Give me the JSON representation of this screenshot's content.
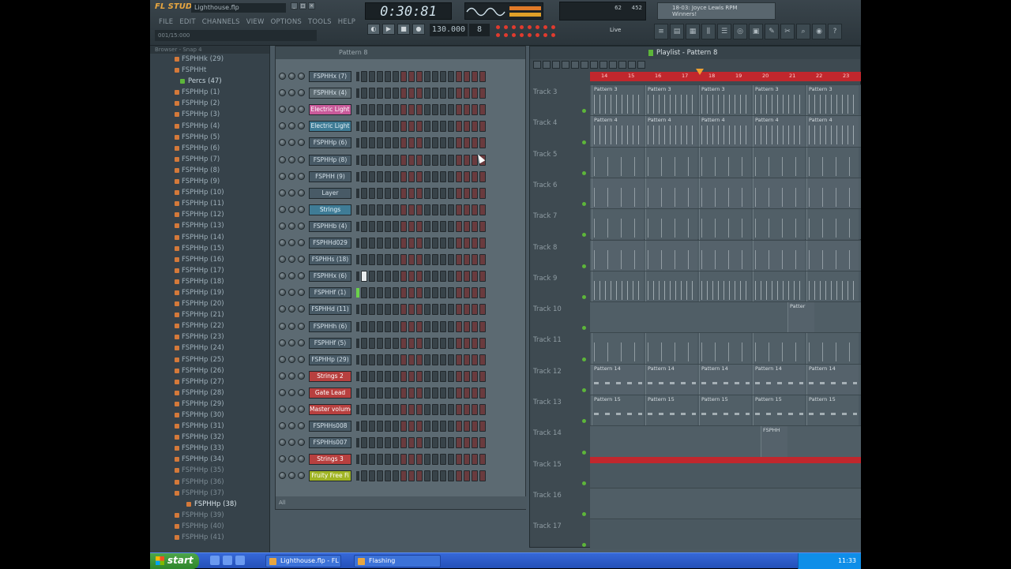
{
  "app": {
    "logo": "FL STUDIO",
    "title": "Lighthouse.flp"
  },
  "menu": [
    "FILE",
    "EDIT",
    "CHANNELS",
    "VIEW",
    "OPTIONS",
    "TOOLS",
    "HELP"
  ],
  "hint": "001/15:000",
  "transport": {
    "time": "0:30:81",
    "tempo": "130.000",
    "pattern": "8",
    "live": "Live",
    "cpu": "62",
    "mem": "452"
  },
  "news": "18-03: Joyce Lewis RPM Winners!",
  "browser": {
    "header": "Browser - Snap 4",
    "items": [
      "FSPHHk (29)",
      "FSPHHt",
      "Percs (47)",
      "FSPHHp (1)",
      "FSPHHp (2)",
      "FSPHHp (3)",
      "FSPHHp (4)",
      "FSPHHp (5)",
      "FSPHHp (6)",
      "FSPHHp (7)",
      "FSPHHp (8)",
      "FSPHHp (9)",
      "FSPHHp (10)",
      "FSPHHp (11)",
      "FSPHHp (12)",
      "FSPHHp (13)",
      "FSPHHp (14)",
      "FSPHHp (15)",
      "FSPHHp (16)",
      "FSPHHp (17)",
      "FSPHHp (18)",
      "FSPHHp (19)",
      "FSPHHp (20)",
      "FSPHHp (21)",
      "FSPHHp (22)",
      "FSPHHp (23)",
      "FSPHHp (24)",
      "FSPHHp (25)",
      "FSPHHp (26)",
      "FSPHHp (27)",
      "FSPHHp (28)",
      "FSPHHp (29)",
      "FSPHHp (30)",
      "FSPHHp (31)",
      "FSPHHp (32)",
      "FSPHHp (33)",
      "FSPHHp (34)",
      "FSPHHp (35)",
      "FSPHHp (36)",
      "FSPHHp (37)",
      "FSPHHp (38)",
      "FSPHHp (39)",
      "FSPHHp (40)",
      "FSPHHp (41)"
    ]
  },
  "sequencer": {
    "title": "Pattern 8",
    "footer": "All",
    "channels": [
      {
        "name": "FSPHHx (7)",
        "style": "",
        "sel": false
      },
      {
        "name": "FSPHHx (4)",
        "style": "grey",
        "sel": false
      },
      {
        "name": "Electric Light",
        "style": "pink",
        "sel": false
      },
      {
        "name": "Electric Light",
        "style": "teal",
        "sel": false
      },
      {
        "name": "FSPHHp (6)",
        "style": "",
        "sel": false
      },
      {
        "name": "FSPHHp (8)",
        "style": "",
        "sel": false
      },
      {
        "name": "FSPHH (9)",
        "style": "",
        "sel": false
      },
      {
        "name": "Layer",
        "style": "",
        "sel": false
      },
      {
        "name": "Strings",
        "style": "teal",
        "sel": false
      },
      {
        "name": "FSPHHb (4)",
        "style": "",
        "sel": false
      },
      {
        "name": "FSPHHd029",
        "style": "",
        "sel": false
      },
      {
        "name": "FSPHHs (18)",
        "style": "",
        "sel": false
      },
      {
        "name": "FSPHHx (6)",
        "style": "",
        "sel": false
      },
      {
        "name": "FSPHHf (1)",
        "style": "",
        "sel": true
      },
      {
        "name": "FSPHHd (11)",
        "style": "",
        "sel": false
      },
      {
        "name": "FSPHHh (6)",
        "style": "",
        "sel": false
      },
      {
        "name": "FSPHHf (5)",
        "style": "",
        "sel": false
      },
      {
        "name": "FSPHHp (29)",
        "style": "",
        "sel": false
      },
      {
        "name": "Strings 2",
        "style": "red",
        "sel": false
      },
      {
        "name": "Gate Lead",
        "style": "red",
        "sel": false
      },
      {
        "name": "Master volume",
        "style": "red",
        "sel": false
      },
      {
        "name": "FSPHHs008",
        "style": "",
        "sel": false
      },
      {
        "name": "FSPHHs007",
        "style": "",
        "sel": false
      },
      {
        "name": "Strings 3",
        "style": "red",
        "sel": false
      },
      {
        "name": "Fruity Free Fi",
        "style": "lime",
        "sel": false
      }
    ]
  },
  "playlist": {
    "title": "Playlist - Pattern 8",
    "ruler": [
      "14",
      "15",
      "16",
      "17",
      "18",
      "19",
      "20",
      "21",
      "22",
      "23"
    ],
    "tracks": [
      {
        "name": "Track 3",
        "clip": "Pattern 3",
        "fill": "dense"
      },
      {
        "name": "Track 4",
        "clip": "Pattern 4",
        "fill": "dense"
      },
      {
        "name": "Track 5",
        "clip": "",
        "fill": "sparse"
      },
      {
        "name": "Track 6",
        "clip": "",
        "fill": "sparse"
      },
      {
        "name": "Track 7",
        "clip": "",
        "fill": "sparse"
      },
      {
        "name": "Track 8",
        "clip": "",
        "fill": "sparse"
      },
      {
        "name": "Track 9",
        "clip": "",
        "fill": "dense"
      },
      {
        "name": "Track 10",
        "clip": "Patter",
        "fill": "none"
      },
      {
        "name": "Track 11",
        "clip": "",
        "fill": "sparse"
      },
      {
        "name": "Track 12",
        "clip": "Pattern 14",
        "fill": "bars"
      },
      {
        "name": "Track 13",
        "clip": "Pattern 15",
        "fill": "bars"
      },
      {
        "name": "Track 14",
        "clip": "FSPHH",
        "fill": "none"
      },
      {
        "name": "Track 15",
        "clip": "",
        "fill": "red"
      },
      {
        "name": "Track 16",
        "clip": "",
        "fill": "none"
      },
      {
        "name": "Track 17",
        "clip": "",
        "fill": "none"
      }
    ]
  },
  "taskbar": {
    "start": "start",
    "tasks": [
      "Lighthouse.flp - FL St...",
      "Flashing"
    ],
    "clock": "11:33"
  }
}
